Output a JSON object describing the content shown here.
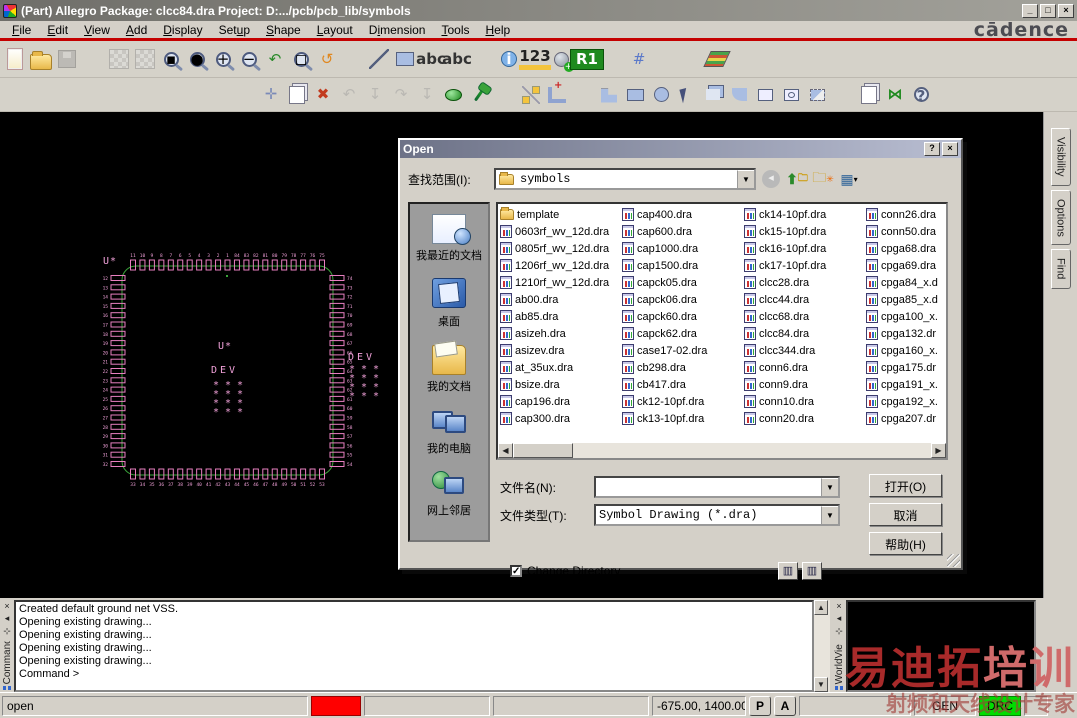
{
  "window": {
    "title": "(Part) Allegro Package: clcc84.dra  Project: D:.../pcb/pcb_lib/symbols",
    "minimize": "_",
    "maximize": "□",
    "close": "×"
  },
  "brand": {
    "logo": "cādence",
    "accent_red": "#c40000"
  },
  "menus": [
    {
      "id": "menu-file",
      "pre": "",
      "u": "F",
      "post": "ile"
    },
    {
      "id": "menu-edit",
      "pre": "",
      "u": "E",
      "post": "dit"
    },
    {
      "id": "menu-view",
      "pre": "",
      "u": "V",
      "post": "iew"
    },
    {
      "id": "menu-add",
      "pre": "",
      "u": "A",
      "post": "dd"
    },
    {
      "id": "menu-display",
      "pre": "",
      "u": "D",
      "post": "isplay"
    },
    {
      "id": "menu-setup",
      "pre": "Set",
      "u": "u",
      "post": "p"
    },
    {
      "id": "menu-shape",
      "pre": "",
      "u": "S",
      "post": "hape"
    },
    {
      "id": "menu-layout",
      "pre": "",
      "u": "L",
      "post": "ayout"
    },
    {
      "id": "menu-dimension",
      "pre": "D",
      "u": "i",
      "post": "mension"
    },
    {
      "id": "menu-tools",
      "pre": "",
      "u": "T",
      "post": "ools"
    },
    {
      "id": "menu-help",
      "pre": "",
      "u": "H",
      "post": "elp"
    }
  ],
  "toolbar1": [
    {
      "n": "new-drawing-icon",
      "t": "i-new"
    },
    {
      "n": "open-drawing-icon",
      "t": "i-open"
    },
    {
      "n": "save-drawing-icon",
      "t": "i-save",
      "d": 1
    },
    {
      "t": "sep",
      "n": "toolbar-handle"
    },
    {
      "n": "grid-settings-icon",
      "t": "i-grid1",
      "d": 1
    },
    {
      "n": "grid-toggle-icon",
      "t": "i-grid2",
      "d": 1
    },
    {
      "n": "zoom-points-icon",
      "t": "mag m-pts",
      "g": "▪"
    },
    {
      "n": "zoom-world-icon",
      "t": "mag m-world",
      "g": "●"
    },
    {
      "n": "zoom-in-icon",
      "t": "mag m-in",
      "g": "+"
    },
    {
      "n": "zoom-out-icon",
      "t": "mag m-out",
      "g": "−"
    },
    {
      "n": "zoom-previous-icon",
      "t": "g-green",
      "g": "↶"
    },
    {
      "n": "zoom-selection-icon",
      "t": "mag m-pts",
      "g": "◻"
    },
    {
      "n": "redraw-icon",
      "t": "g-orange",
      "g": "↺"
    },
    {
      "t": "sep",
      "n": "toolbar-handle"
    },
    {
      "n": "add-line-icon",
      "t": "i-line"
    },
    {
      "n": "add-rect-icon",
      "t": "i-rect"
    },
    {
      "n": "add-text-icon",
      "t": "i-abc abc-add",
      "g": "abc"
    },
    {
      "n": "edit-text-icon",
      "t": "i-abc abc-edit",
      "g": "abc"
    },
    {
      "t": "sep",
      "n": "toolbar-handle"
    },
    {
      "n": "show-element-icon",
      "t": "i-info",
      "g": "i"
    },
    {
      "n": "measure-icon",
      "t": "i-123",
      "g": "123"
    },
    {
      "n": "snap-pick-icon",
      "t": "i-ball"
    },
    {
      "n": "refdes-toggle-icon",
      "t": "i-r1",
      "g": "R1"
    },
    {
      "t": "sep",
      "n": "toolbar-handle"
    },
    {
      "n": "grid-display-icon",
      "t": "g-blue",
      "g": "#"
    },
    {
      "n": "color-visibility-icon",
      "t": "i-colors"
    },
    {
      "n": "color-priority-icon",
      "t": "i-colors2"
    },
    {
      "n": "layers-icon",
      "t": "i-layers"
    }
  ],
  "toolbar2": [
    {
      "t": "sep",
      "n": "toolbar-handle"
    },
    {
      "n": "move-icon",
      "t": "i-move",
      "g": "✛"
    },
    {
      "n": "copy-icon",
      "t": "i-copy"
    },
    {
      "n": "delete-icon",
      "t": "g-red",
      "g": "✖"
    },
    {
      "n": "undo-icon",
      "t": "g-gray",
      "g": "↶",
      "d": 1
    },
    {
      "n": "done-icon",
      "t": "g-gray",
      "g": "↧",
      "d": 1
    },
    {
      "n": "redo-icon",
      "t": "g-gray",
      "g": "↷",
      "d": 1
    },
    {
      "n": "next-icon",
      "t": "g-gray",
      "g": "↧",
      "d": 1
    },
    {
      "n": "highlight-icon",
      "t": "i-blob"
    },
    {
      "n": "pin-icon",
      "t": "i-pin"
    },
    {
      "t": "sep",
      "n": "toolbar-handle"
    },
    {
      "n": "slide-icon",
      "t": "i-slide"
    },
    {
      "n": "vertex-icon",
      "t": "i-corner"
    },
    {
      "t": "sep gap",
      "n": "toolbar-handle"
    },
    {
      "n": "shape-polygon-icon",
      "t": "i-shL"
    },
    {
      "n": "shape-rect-icon",
      "t": "sh i-shRect"
    },
    {
      "n": "shape-circle-icon",
      "t": "sh i-shCirc"
    },
    {
      "n": "shape-select-icon",
      "t": "i-cursor"
    },
    {
      "n": "shape-copy-icon",
      "t": "i-shCopy"
    },
    {
      "n": "shape-manual-void-icon",
      "t": "i-shArc"
    },
    {
      "n": "void-rect-icon",
      "t": "sh i-shRectO"
    },
    {
      "n": "void-circle-icon",
      "t": "sh i-shCircO"
    },
    {
      "n": "void-delete-icon",
      "t": "i-shDel"
    },
    {
      "t": "sep",
      "n": "toolbar-handle"
    },
    {
      "n": "properties-icon",
      "t": "i-props"
    },
    {
      "n": "bowtie-check-icon",
      "t": "i-bowtie",
      "g": "⋈"
    },
    {
      "n": "help-icon",
      "t": "i-help",
      "g": "?"
    }
  ],
  "side_tabs": [
    {
      "id": "tab-visibility",
      "label": "Visibility"
    },
    {
      "id": "tab-options",
      "label": "Options"
    },
    {
      "id": "tab-find",
      "label": "Find"
    }
  ],
  "chip": {
    "corner_ref": "U*",
    "center_ref": "U*",
    "center_dev": "DEV",
    "side_dev": "DEV",
    "pins_top": [
      "11",
      "10",
      "9",
      "8",
      "7",
      "6",
      "5",
      "4",
      "3",
      "2",
      "1",
      "84",
      "83",
      "82",
      "81",
      "80",
      "79",
      "78",
      "77",
      "76",
      "75"
    ],
    "pins_left": [
      "12",
      "13",
      "14",
      "15",
      "16",
      "17",
      "18",
      "19",
      "20",
      "21",
      "22",
      "23",
      "24",
      "25",
      "26",
      "27",
      "28",
      "29",
      "30",
      "31",
      "32"
    ],
    "pins_right": [
      "74",
      "73",
      "72",
      "71",
      "70",
      "69",
      "68",
      "67",
      "66",
      "65",
      "64",
      "63",
      "62",
      "61",
      "60",
      "59",
      "58",
      "57",
      "56",
      "55",
      "54"
    ],
    "pins_bottom": [
      "33",
      "34",
      "35",
      "36",
      "37",
      "38",
      "39",
      "40",
      "41",
      "42",
      "43",
      "44",
      "45",
      "46",
      "47",
      "48",
      "49",
      "50",
      "51",
      "52",
      "53"
    ],
    "outline_color": "#3aa33a",
    "pad_color": "#e87fc0",
    "text_color": "#f0a0d8"
  },
  "dialog": {
    "title": "Open",
    "help_btn": "?",
    "close_btn": "×",
    "look_in_label": "查找范围(I):",
    "look_in_value": "symbols",
    "places": [
      {
        "name": "place-recent-documents",
        "icon": "pi-recent",
        "label": "我最近的文档"
      },
      {
        "name": "place-desktop",
        "icon": "pi-desktop",
        "label": "桌面"
      },
      {
        "name": "place-my-documents",
        "icon": "pi-docs",
        "label": "我的文档"
      },
      {
        "name": "place-my-computer",
        "icon": "pi-computer",
        "label": "我的电脑"
      },
      {
        "name": "place-network",
        "icon": "pi-network",
        "label": "网上邻居"
      }
    ],
    "files_col1": [
      {
        "n": "template",
        "t": "fold"
      },
      {
        "n": "0603rf_wv_12d.dra",
        "t": "dra"
      },
      {
        "n": "0805rf_wv_12d.dra",
        "t": "dra"
      },
      {
        "n": "1206rf_wv_12d.dra",
        "t": "dra"
      },
      {
        "n": "1210rf_wv_12d.dra",
        "t": "dra"
      },
      {
        "n": "ab00.dra",
        "t": "dra"
      },
      {
        "n": "ab85.dra",
        "t": "dra"
      },
      {
        "n": "asizeh.dra",
        "t": "dra"
      },
      {
        "n": "asizev.dra",
        "t": "dra"
      },
      {
        "n": "at_35ux.dra",
        "t": "dra"
      },
      {
        "n": "bsize.dra",
        "t": "dra"
      },
      {
        "n": "cap196.dra",
        "t": "dra"
      },
      {
        "n": "cap300.dra",
        "t": "dra"
      }
    ],
    "files_col2": [
      {
        "n": "cap400.dra",
        "t": "dra"
      },
      {
        "n": "cap600.dra",
        "t": "dra"
      },
      {
        "n": "cap1000.dra",
        "t": "dra"
      },
      {
        "n": "cap1500.dra",
        "t": "dra"
      },
      {
        "n": "capck05.dra",
        "t": "dra"
      },
      {
        "n": "capck06.dra",
        "t": "dra"
      },
      {
        "n": "capck60.dra",
        "t": "dra"
      },
      {
        "n": "capck62.dra",
        "t": "dra"
      },
      {
        "n": "case17-02.dra",
        "t": "dra"
      },
      {
        "n": "cb298.dra",
        "t": "dra"
      },
      {
        "n": "cb417.dra",
        "t": "dra"
      },
      {
        "n": "ck12-10pf.dra",
        "t": "dra"
      },
      {
        "n": "ck13-10pf.dra",
        "t": "dra"
      }
    ],
    "files_col3": [
      {
        "n": "ck14-10pf.dra",
        "t": "dra"
      },
      {
        "n": "ck15-10pf.dra",
        "t": "dra"
      },
      {
        "n": "ck16-10pf.dra",
        "t": "dra"
      },
      {
        "n": "ck17-10pf.dra",
        "t": "dra"
      },
      {
        "n": "clcc28.dra",
        "t": "dra"
      },
      {
        "n": "clcc44.dra",
        "t": "dra"
      },
      {
        "n": "clcc68.dra",
        "t": "dra"
      },
      {
        "n": "clcc84.dra",
        "t": "dra"
      },
      {
        "n": "clcc344.dra",
        "t": "dra"
      },
      {
        "n": "conn6.dra",
        "t": "dra"
      },
      {
        "n": "conn9.dra",
        "t": "dra"
      },
      {
        "n": "conn10.dra",
        "t": "dra"
      },
      {
        "n": "conn20.dra",
        "t": "dra"
      }
    ],
    "files_col4": [
      {
        "n": "conn26.dra",
        "t": "dra"
      },
      {
        "n": "conn50.dra",
        "t": "dra"
      },
      {
        "n": "cpga68.dra",
        "t": "dra"
      },
      {
        "n": "cpga69.dra",
        "t": "dra"
      },
      {
        "n": "cpga84_x.d",
        "t": "dra"
      },
      {
        "n": "cpga85_x.d",
        "t": "dra"
      },
      {
        "n": "cpga100_x.",
        "t": "dra"
      },
      {
        "n": "cpga132.dr",
        "t": "dra"
      },
      {
        "n": "cpga160_x.",
        "t": "dra"
      },
      {
        "n": "cpga175.dr",
        "t": "dra"
      },
      {
        "n": "cpga191_x.",
        "t": "dra"
      },
      {
        "n": "cpga192_x.",
        "t": "dra"
      },
      {
        "n": "cpga207.dr",
        "t": "dra"
      }
    ],
    "file_name_label": "文件名(N):",
    "file_name_value": "",
    "file_type_label": "文件类型(T):",
    "file_type_value": "Symbol Drawing (*.dra)",
    "open_button": "打开(O)",
    "cancel_button": "取消",
    "help_button": "帮助(H)",
    "change_dir_label": "Change Directory",
    "change_dir_checked": "✓",
    "view_btn1": "▥",
    "view_btn2": "▥"
  },
  "command": {
    "panel_label": "Command",
    "lines": [
      "Created default ground net VSS.",
      "Opening existing drawing...",
      "Opening existing drawing...",
      "Opening existing drawing...",
      "Opening existing drawing...",
      "Command >"
    ]
  },
  "worldview": {
    "panel_label": "WorldVie"
  },
  "status": {
    "mode": "open",
    "coords": "-675.00, 1400.00",
    "p_button": "P",
    "a_button": "A",
    "gen": "GEN",
    "drc": "DRC"
  },
  "watermark": {
    "part1": "易迪拓",
    "part2": "培训",
    "line2": "射频和天线设计专家"
  }
}
